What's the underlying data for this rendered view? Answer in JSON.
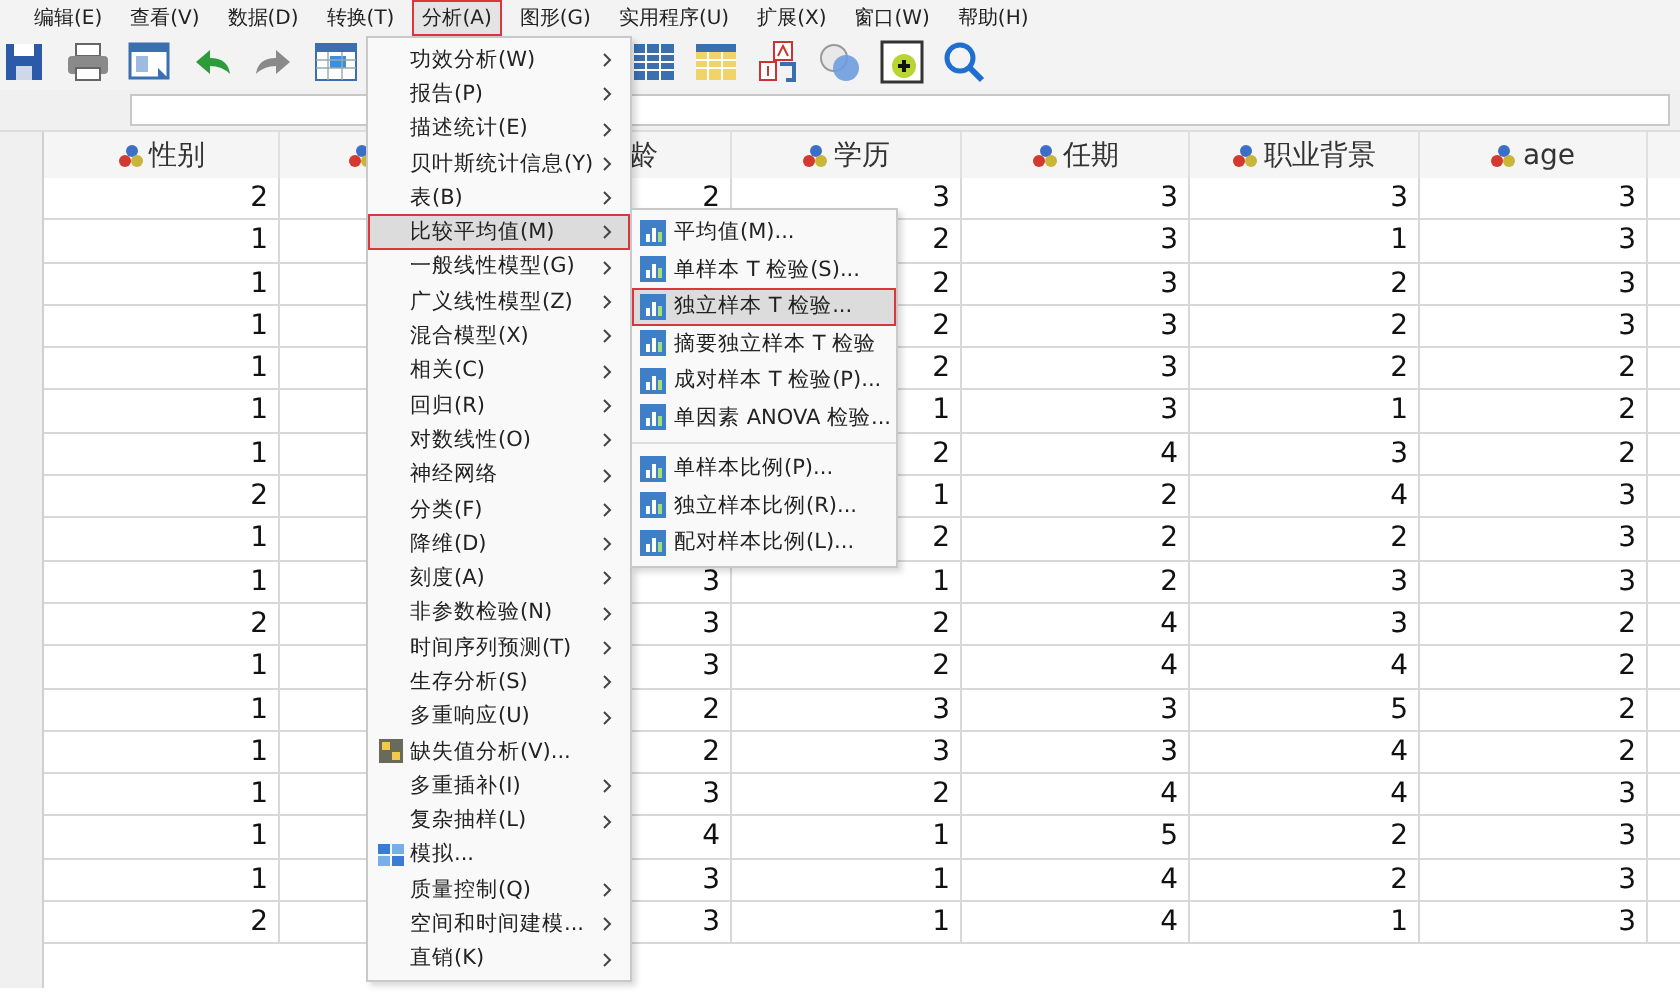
{
  "menu_bar": [
    {
      "label": "编辑(E)",
      "selected": false
    },
    {
      "label": "查看(V)",
      "selected": false
    },
    {
      "label": "数据(D)",
      "selected": false
    },
    {
      "label": "转换(T)",
      "selected": false
    },
    {
      "label": "分析(A)",
      "selected": true
    },
    {
      "label": "图形(G)",
      "selected": false
    },
    {
      "label": "实用程序(U)",
      "selected": false
    },
    {
      "label": "扩展(X)",
      "selected": false
    },
    {
      "label": "窗口(W)",
      "selected": false
    },
    {
      "label": "帮助(H)",
      "selected": false
    }
  ],
  "table": {
    "columns": [
      {
        "name": "性别",
        "icon": true
      },
      {
        "icon": true
      },
      {
        "name": "龄",
        "icon": false
      },
      {
        "name": "学历",
        "icon": true
      },
      {
        "name": "任期",
        "icon": true
      },
      {
        "name": "职业背景",
        "icon": true
      },
      {
        "name": "age",
        "icon": true
      }
    ],
    "rows": [
      [
        "2",
        null,
        "2",
        "3",
        "3",
        "3",
        "3"
      ],
      [
        "1",
        null,
        null,
        "2",
        "3",
        "1",
        "3"
      ],
      [
        "1",
        null,
        null,
        "2",
        "3",
        "2",
        "3"
      ],
      [
        "1",
        null,
        null,
        "2",
        "3",
        "2",
        "3"
      ],
      [
        "1",
        null,
        null,
        "2",
        "3",
        "2",
        "2"
      ],
      [
        "1",
        null,
        null,
        "1",
        "3",
        "1",
        "2"
      ],
      [
        "1",
        null,
        null,
        "2",
        "4",
        "3",
        "2"
      ],
      [
        "2",
        null,
        null,
        "1",
        "2",
        "4",
        "3"
      ],
      [
        "1",
        null,
        null,
        "2",
        "2",
        "2",
        "3"
      ],
      [
        "1",
        null,
        "3",
        "1",
        "2",
        "3",
        "3"
      ],
      [
        "2",
        null,
        "3",
        "2",
        "4",
        "3",
        "2"
      ],
      [
        "1",
        null,
        "3",
        "2",
        "4",
        "4",
        "2"
      ],
      [
        "1",
        null,
        "2",
        "3",
        "3",
        "5",
        "2"
      ],
      [
        "1",
        null,
        "2",
        "3",
        "3",
        "4",
        "2"
      ],
      [
        "1",
        null,
        "3",
        "2",
        "4",
        "4",
        "3"
      ],
      [
        "1",
        null,
        "4",
        "1",
        "5",
        "2",
        "3"
      ],
      [
        "1",
        null,
        "3",
        "1",
        "4",
        "2",
        "3"
      ],
      [
        "2",
        null,
        "3",
        "1",
        "4",
        "1",
        "3"
      ]
    ]
  },
  "analyze_menu": [
    {
      "label": "功效分析(W)",
      "kind": "submenu",
      "selected": false
    },
    {
      "label": "报告(P)",
      "kind": "submenu",
      "selected": false
    },
    {
      "label": "描述统计(E)",
      "kind": "submenu",
      "selected": false
    },
    {
      "label": "贝叶斯统计信息(Y)",
      "kind": "submenu",
      "selected": false
    },
    {
      "label": "表(B)",
      "kind": "submenu",
      "selected": false
    },
    {
      "label": "比较平均值(M)",
      "kind": "submenu",
      "selected": true
    },
    {
      "label": "一般线性模型(G)",
      "kind": "submenu",
      "selected": false
    },
    {
      "label": "广义线性模型(Z)",
      "kind": "submenu",
      "selected": false
    },
    {
      "label": "混合模型(X)",
      "kind": "submenu",
      "selected": false
    },
    {
      "label": "相关(C)",
      "kind": "submenu",
      "selected": false
    },
    {
      "label": "回归(R)",
      "kind": "submenu",
      "selected": false
    },
    {
      "label": "对数线性(O)",
      "kind": "submenu",
      "selected": false
    },
    {
      "label": "神经网络",
      "kind": "submenu",
      "selected": false
    },
    {
      "label": "分类(F)",
      "kind": "submenu",
      "selected": false
    },
    {
      "label": "降维(D)",
      "kind": "submenu",
      "selected": false
    },
    {
      "label": "刻度(A)",
      "kind": "submenu",
      "selected": false
    },
    {
      "label": "非参数检验(N)",
      "kind": "submenu",
      "selected": false
    },
    {
      "label": "时间序列预测(T)",
      "kind": "submenu",
      "selected": false
    },
    {
      "label": "生存分析(S)",
      "kind": "submenu",
      "selected": false
    },
    {
      "label": "多重响应(U)",
      "kind": "submenu",
      "selected": false
    },
    {
      "label": "缺失值分析(V)...",
      "kind": "grid",
      "selected": false
    },
    {
      "label": "多重插补(I)",
      "kind": "submenu",
      "selected": false
    },
    {
      "label": "复杂抽样(L)",
      "kind": "submenu",
      "selected": false
    },
    {
      "label": "模拟...",
      "kind": "blocks",
      "selected": false
    },
    {
      "label": "质量控制(Q)",
      "kind": "submenu",
      "selected": false
    },
    {
      "label": "空间和时间建模...",
      "kind": "submenu",
      "selected": false
    },
    {
      "label": "直销(K)",
      "kind": "submenu",
      "selected": false
    }
  ],
  "compare_means_submenu": [
    [
      {
        "label": "平均值(M)...",
        "selected": false
      },
      {
        "label": "单样本 T 检验(S)...",
        "selected": false
      },
      {
        "label": "独立样本 T 检验...",
        "selected": true
      },
      {
        "label": "摘要独立样本 T 检验",
        "selected": false
      },
      {
        "label": "成对样本 T 检验(P)...",
        "selected": false
      },
      {
        "label": "单因素 ANOVA 检验...",
        "selected": false
      }
    ],
    [
      {
        "label": "单样本比例(P)...",
        "selected": false
      },
      {
        "label": "独立样本比例(R)...",
        "selected": false
      },
      {
        "label": "配对样本比例(L)...",
        "selected": false
      }
    ]
  ]
}
